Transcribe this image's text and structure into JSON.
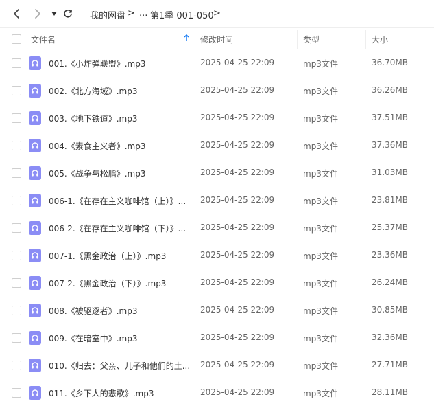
{
  "nav": {
    "crumb_root": "我的网盘",
    "crumb_ellipsis": "...",
    "crumb_current": "第1季 001-050",
    "arrow": ">"
  },
  "header": {
    "name": "文件名",
    "modified": "修改时间",
    "type": "类型",
    "size": "大小"
  },
  "colors": {
    "accent": "#1a7cf2",
    "file_icon": "#8b8df5"
  },
  "files": [
    {
      "name": "001.《小炸弹联盟》.mp3",
      "modified": "2025-04-25 22:09",
      "type": "mp3文件",
      "size": "36.70MB"
    },
    {
      "name": "002.《北方海域》.mp3",
      "modified": "2025-04-25 22:09",
      "type": "mp3文件",
      "size": "36.26MB"
    },
    {
      "name": "003.《地下铁道》.mp3",
      "modified": "2025-04-25 22:09",
      "type": "mp3文件",
      "size": "37.51MB"
    },
    {
      "name": "004.《素食主义者》.mp3",
      "modified": "2025-04-25 22:09",
      "type": "mp3文件",
      "size": "37.36MB"
    },
    {
      "name": "005.《战争与松脂》.mp3",
      "modified": "2025-04-25 22:09",
      "type": "mp3文件",
      "size": "31.03MB"
    },
    {
      "name": "006-1.《在存在主义咖啡馆（上）》...",
      "modified": "2025-04-25 22:09",
      "type": "mp3文件",
      "size": "23.81MB"
    },
    {
      "name": "006-2.《在存在主义咖啡馆（下）》...",
      "modified": "2025-04-25 22:09",
      "type": "mp3文件",
      "size": "25.37MB"
    },
    {
      "name": "007-1.《黑金政治（上）》.mp3",
      "modified": "2025-04-25 22:09",
      "type": "mp3文件",
      "size": "23.36MB"
    },
    {
      "name": "007-2.《黑金政治（下）》.mp3",
      "modified": "2025-04-25 22:09",
      "type": "mp3文件",
      "size": "26.24MB"
    },
    {
      "name": "008.《被驱逐者》.mp3",
      "modified": "2025-04-25 22:09",
      "type": "mp3文件",
      "size": "30.85MB"
    },
    {
      "name": "009.《在暗室中》.mp3",
      "modified": "2025-04-25 22:09",
      "type": "mp3文件",
      "size": "32.36MB"
    },
    {
      "name": "010.《归去：父亲、儿子和他们的土...",
      "modified": "2025-04-25 22:09",
      "type": "mp3文件",
      "size": "27.71MB"
    },
    {
      "name": "011.《乡下人的悲歌》.mp3",
      "modified": "2025-04-25 22:09",
      "type": "mp3文件",
      "size": "28.11MB"
    }
  ]
}
